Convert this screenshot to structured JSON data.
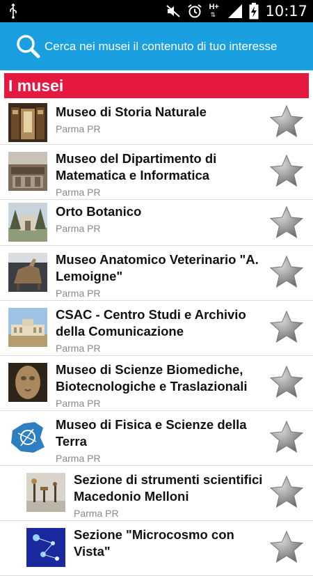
{
  "status_bar": {
    "time": "10:17",
    "network": "H+"
  },
  "search": {
    "text": "Cerca nei musei il contenuto di tuo interesse"
  },
  "section": {
    "title": "I musei"
  },
  "items": [
    {
      "title": "Museo di Storia Naturale",
      "subtitle": "Parma PR"
    },
    {
      "title": "Museo del Dipartimento di Matematica e Informatica",
      "subtitle": "Parma PR"
    },
    {
      "title": "Orto Botanico",
      "subtitle": "Parma PR"
    },
    {
      "title": "Museo Anatomico Veterinario \"A. Lemoigne\"",
      "subtitle": "Parma PR"
    },
    {
      "title": "CSAC - Centro Studi e Archivio della Comunicazione",
      "subtitle": "Parma PR"
    },
    {
      "title": "Museo di Scienze Biomediche, Biotecnologiche e Traslazionali",
      "subtitle": "Parma PR"
    },
    {
      "title": "Museo di Fisica e Scienze della Terra",
      "subtitle": "Parma PR"
    },
    {
      "title": "Sezione di strumenti scientifici Macedonio Melloni",
      "subtitle": "Parma PR"
    },
    {
      "title": "Sezione \"Microcosmo con Vista\"",
      "subtitle": ""
    }
  ],
  "colors": {
    "accent_blue": "#1a9fe0",
    "section_red": "#e5193f",
    "star_gray": "#8c8c8c"
  }
}
